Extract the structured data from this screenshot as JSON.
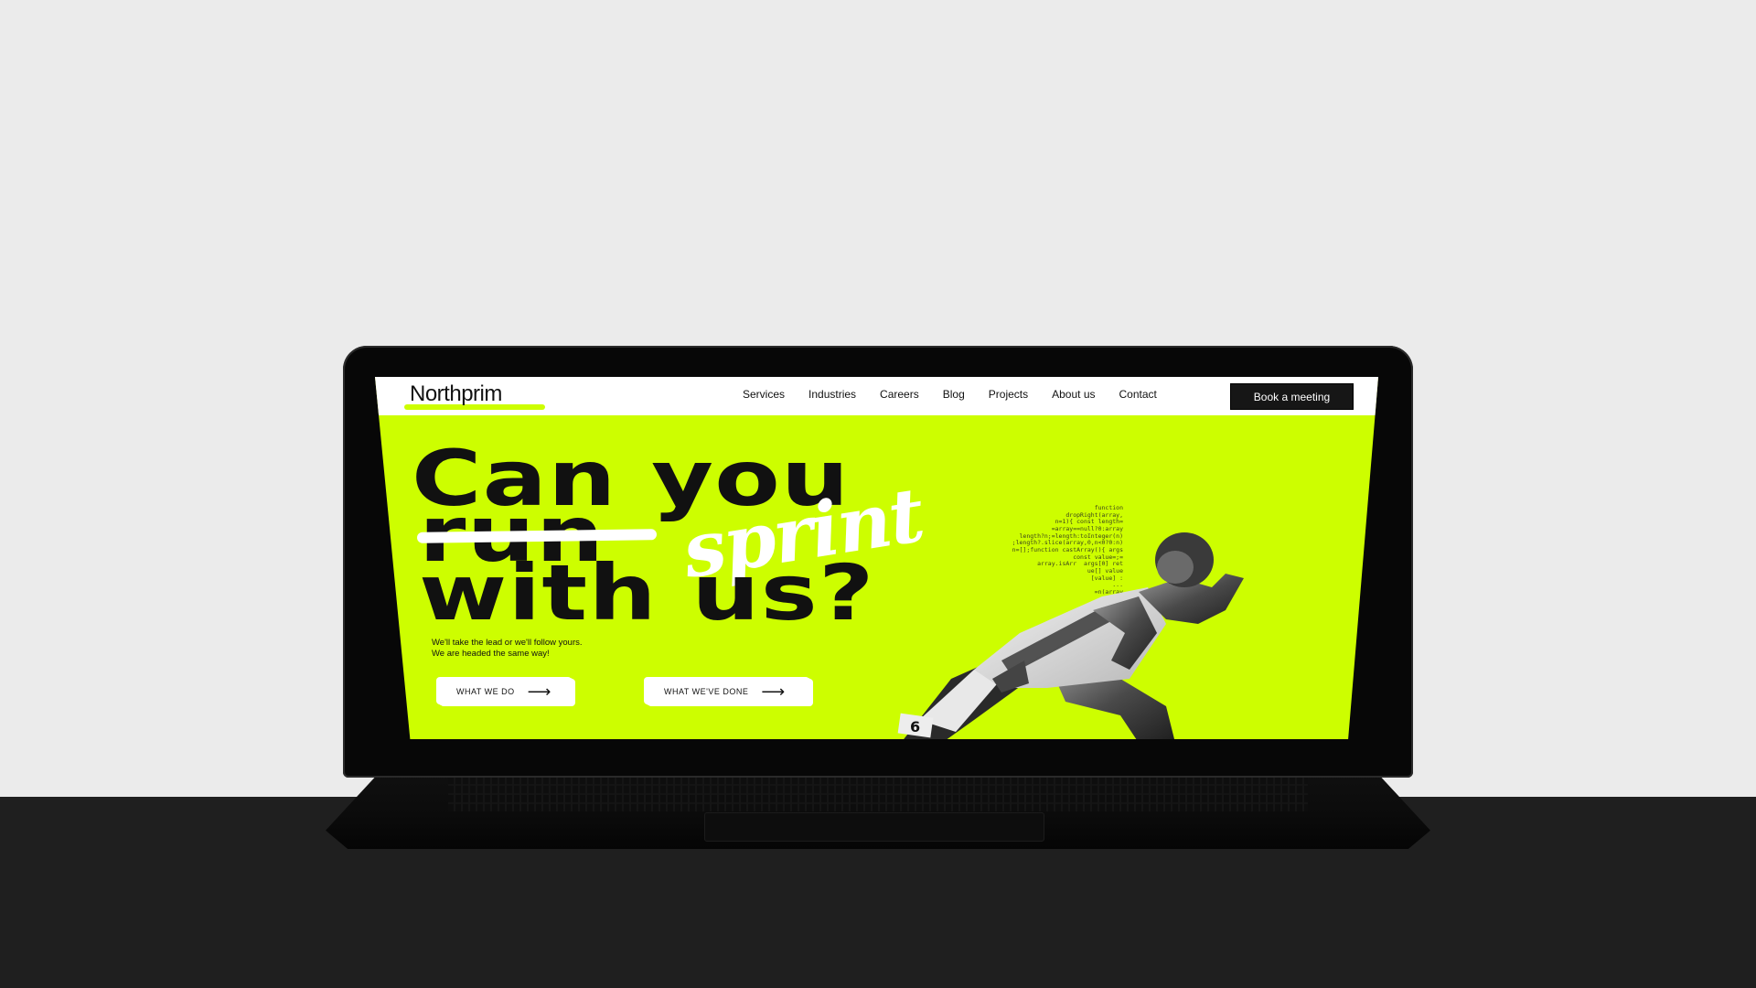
{
  "site": {
    "logo": "Northprim",
    "nav": {
      "links": [
        "Services",
        "Industries",
        "Careers",
        "Blog",
        "Projects",
        "About us",
        "Contact"
      ],
      "cta": "Book a meeting"
    },
    "hero": {
      "line1": "Can you",
      "struck_word": "run",
      "replacement_word": "sprint",
      "line3": "with us?",
      "tagline_line1": "We'll take the lead or we'll follow yours.",
      "tagline_line2": "We are headed the same way!",
      "buttons": [
        {
          "label": "WHAT WE DO",
          "icon": "arrow-right-icon"
        },
        {
          "label": "WHAT WE'VE DONE",
          "icon": "arrow-right-icon"
        }
      ],
      "bib_number": "6"
    }
  },
  "colors": {
    "accent": "#cdfe00",
    "dark": "#161616",
    "background": "#ebebeb",
    "floor": "#1f1f1f"
  }
}
